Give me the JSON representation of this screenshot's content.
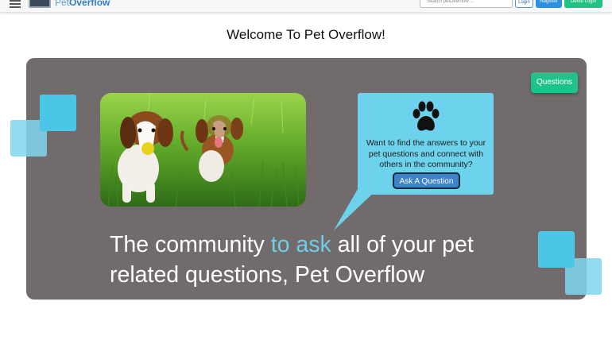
{
  "nav": {
    "logo_prefix": "Pet",
    "logo_suffix": "Overflow",
    "search_placeholder": "Search petOverflow ...",
    "login_label": "Login",
    "register_label": "Register",
    "demo_label": "Demo Login"
  },
  "page": {
    "welcome_title": "Welcome To Pet Overflow!"
  },
  "hero": {
    "questions_button": "Questions",
    "callout_text": "Want to find the answers to your pet questions and connect with others in the community?",
    "ask_button": "Ask A Question",
    "tagline_part1": "The community ",
    "tagline_highlight": "to ask",
    "tagline_part2": " all of your pet related questions, Pet Overflow"
  },
  "icons": {
    "menu": "hamburger-menu-icon",
    "paw": "paw-print-icon"
  },
  "colors": {
    "hero_bg": "#716c6b",
    "accent_cyan": "#4cc6e6",
    "callout_bg": "#6dd2ec",
    "questions_green": "#1fc38a",
    "ask_blue": "#3c84c8",
    "highlight": "#6fcde8"
  }
}
